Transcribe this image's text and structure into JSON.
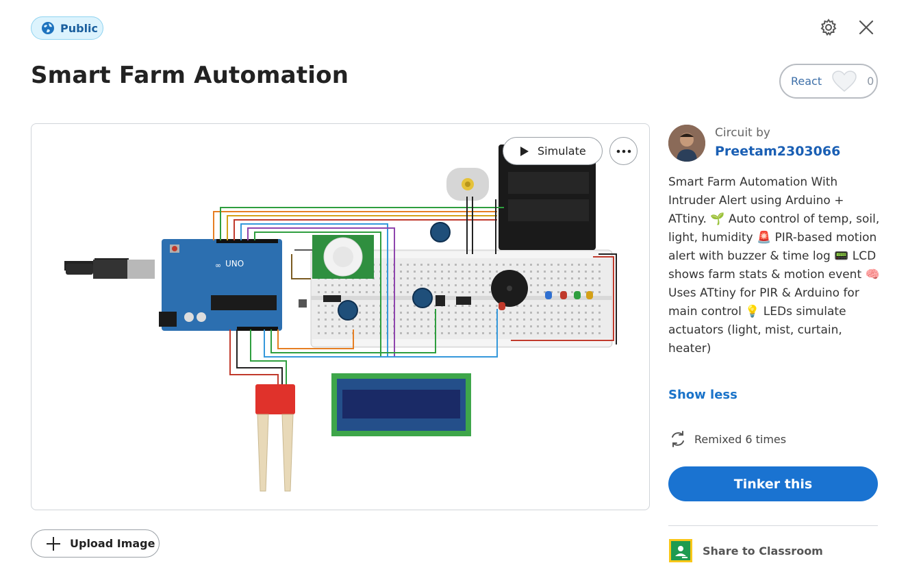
{
  "header": {
    "badge_label": "Public",
    "title": "Smart Farm Automation",
    "react_label": "React",
    "react_count": "0"
  },
  "icons": {
    "badge": "globe-icon",
    "settings": "gear-icon",
    "close": "close-icon",
    "react": "heart-icon",
    "simulate": "play-icon",
    "more": "more-horizontal-icon",
    "upload": "plus-icon",
    "remix": "remix-icon",
    "share": "google-classroom-icon"
  },
  "canvas": {
    "simulate_label": "Simulate",
    "lcd_text": "",
    "components": [
      "Arduino UNO",
      "Breadboard",
      "PIR sensor",
      "LCD 16x2",
      "Soil moisture sensor",
      "DC motor",
      "Battery",
      "Piezo buzzer",
      "Potentiometers",
      "LEDs",
      "ATtiny"
    ]
  },
  "actions": {
    "upload_label": "Upload Image"
  },
  "sidebar": {
    "circuit_by": "Circuit by",
    "author": "Preetam2303066",
    "description": "Smart Farm Automation With Intruder Alert using Arduino + ATtiny. 🌱 Auto control of temp, soil, light, humidity 🚨 PIR-based motion alert with buzzer & time log 📟 LCD shows farm stats & motion event 🧠 Uses ATtiny for PIR & Arduino for main control 💡 LEDs simulate actuators (light, mist, curtain, heater)",
    "show_less": "Show less",
    "remix_text": "Remixed 6 times",
    "tinker_label": "Tinker this",
    "share_label": "Share to Classroom"
  },
  "colors": {
    "accent": "#1a73d1",
    "link": "#1a5fb4",
    "badge_bg": "#dcf3fd"
  }
}
